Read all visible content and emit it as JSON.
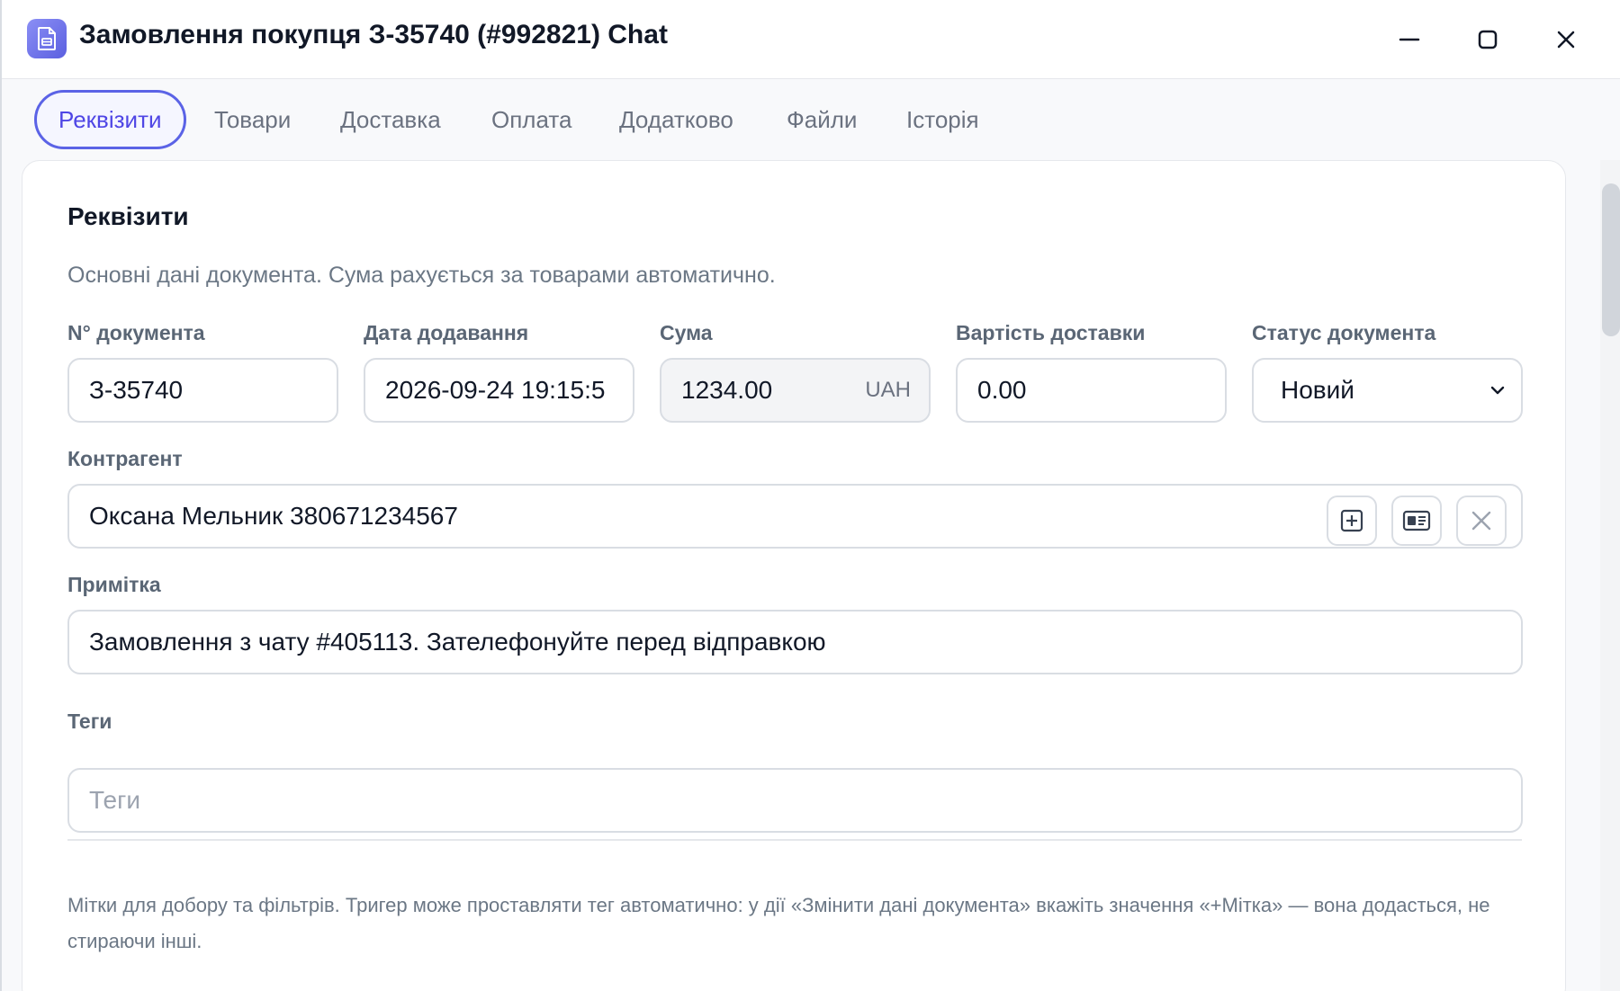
{
  "window": {
    "title": "Замовлення покупця З-35740 (#992821) Chat"
  },
  "tabs": [
    {
      "label": "Реквізити",
      "active": true
    },
    {
      "label": "Товари"
    },
    {
      "label": "Доставка"
    },
    {
      "label": "Оплата"
    },
    {
      "label": "Додатково"
    },
    {
      "label": "Файли"
    },
    {
      "label": "Історія"
    }
  ],
  "section": {
    "title": "Реквізити",
    "description": "Основні дані документа. Сума рахується за товарами автоматично."
  },
  "fields": {
    "doc_number": {
      "label": "N° документа",
      "value": "З-35740"
    },
    "date_added": {
      "label": "Дата додавання",
      "value": "2026-09-24 19:15:5"
    },
    "sum": {
      "label": "Сума",
      "value": "1234.00",
      "currency": "UAH"
    },
    "delivery_cost": {
      "label": "Вартість доставки",
      "value": "0.00"
    },
    "status": {
      "label": "Статус документа",
      "value": "Новий"
    },
    "counterparty": {
      "label": "Контрагент",
      "value": "Оксана Мельник 380671234567"
    },
    "note": {
      "label": "Примітка",
      "value": "Замовлення з чату #405113. Зателефонуйте перед відправкою"
    },
    "tags": {
      "label": "Теги",
      "placeholder": "Теги"
    }
  },
  "hint": "Мітки для добору та фільтрів. Тригер може проставляти тег автоматично: у дії «Змінити дані документа» вкажіть значення «+Мітка» — вона додасться, не стираючи інші.",
  "colors": {
    "accent": "#5b63e6",
    "label": "#5a6675",
    "border": "#d9dde3"
  }
}
